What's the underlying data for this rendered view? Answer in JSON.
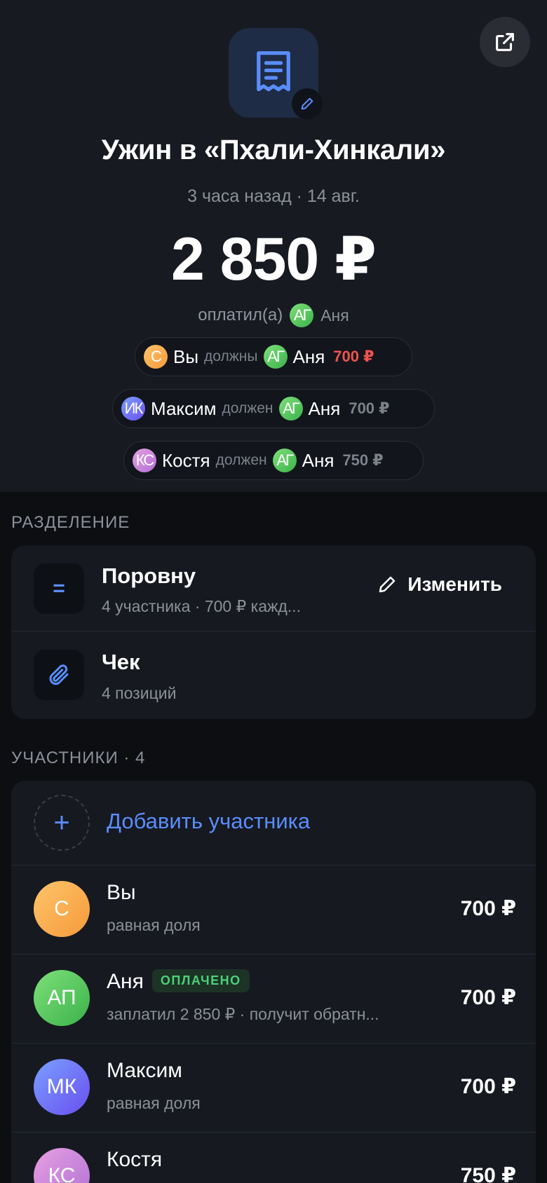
{
  "header": {
    "title": "Ужин в «Пхали-Хинкали»",
    "subtitle": "3 часа назад · 14 авг.",
    "amount": "2 850 ₽",
    "paid_by_label": "оплатил(а)",
    "payer_initials": "АГ",
    "payer_name": "Аня"
  },
  "debts": [
    {
      "from_initials": "С",
      "from_name": "Вы",
      "verb": "должны",
      "to_initials": "АГ",
      "to_name": "Аня",
      "amount": "700 ₽",
      "color": "#ef5350"
    },
    {
      "from_initials": "ИК",
      "from_name": "Максим",
      "verb": "должен",
      "to_initials": "АГ",
      "to_name": "Аня",
      "amount": "700 ₽"
    },
    {
      "from_initials": "КС",
      "from_name": "Костя",
      "verb": "должен",
      "to_initials": "АГ",
      "to_name": "Аня",
      "amount": "750 ₽"
    }
  ],
  "split": {
    "section_label": "РАЗДЕЛЕНИЕ",
    "method_icon": "=",
    "method_title": "Поровну",
    "method_sub": "4 участника · 700 ₽ кажд...",
    "edit_label": "Изменить",
    "receipt_title": "Чек",
    "receipt_sub": "4 позиций"
  },
  "participants": {
    "section_label": "УЧАСТНИКИ · 4",
    "add_icon": "+",
    "add_label": "Добавить участника",
    "items": [
      {
        "initials": "С",
        "name": "Вы",
        "sub": "равная доля",
        "amount": "700 ₽"
      },
      {
        "initials": "АП",
        "name": "Аня",
        "badge": "ОПЛАЧЕНО",
        "sub": "заплатил 2 850 ₽ · получит обратн...",
        "amount": "700 ₽"
      },
      {
        "initials": "МК",
        "name": "Максим",
        "sub": "равная доля",
        "amount": "700 ₽"
      },
      {
        "initials": "КС",
        "name": "Костя",
        "sub": "",
        "amount": "750 ₽"
      }
    ]
  },
  "colors": {
    "accent": "#5a8dff",
    "paid_badge": "#4cd07a",
    "debt_highlight": "#ef5350"
  }
}
